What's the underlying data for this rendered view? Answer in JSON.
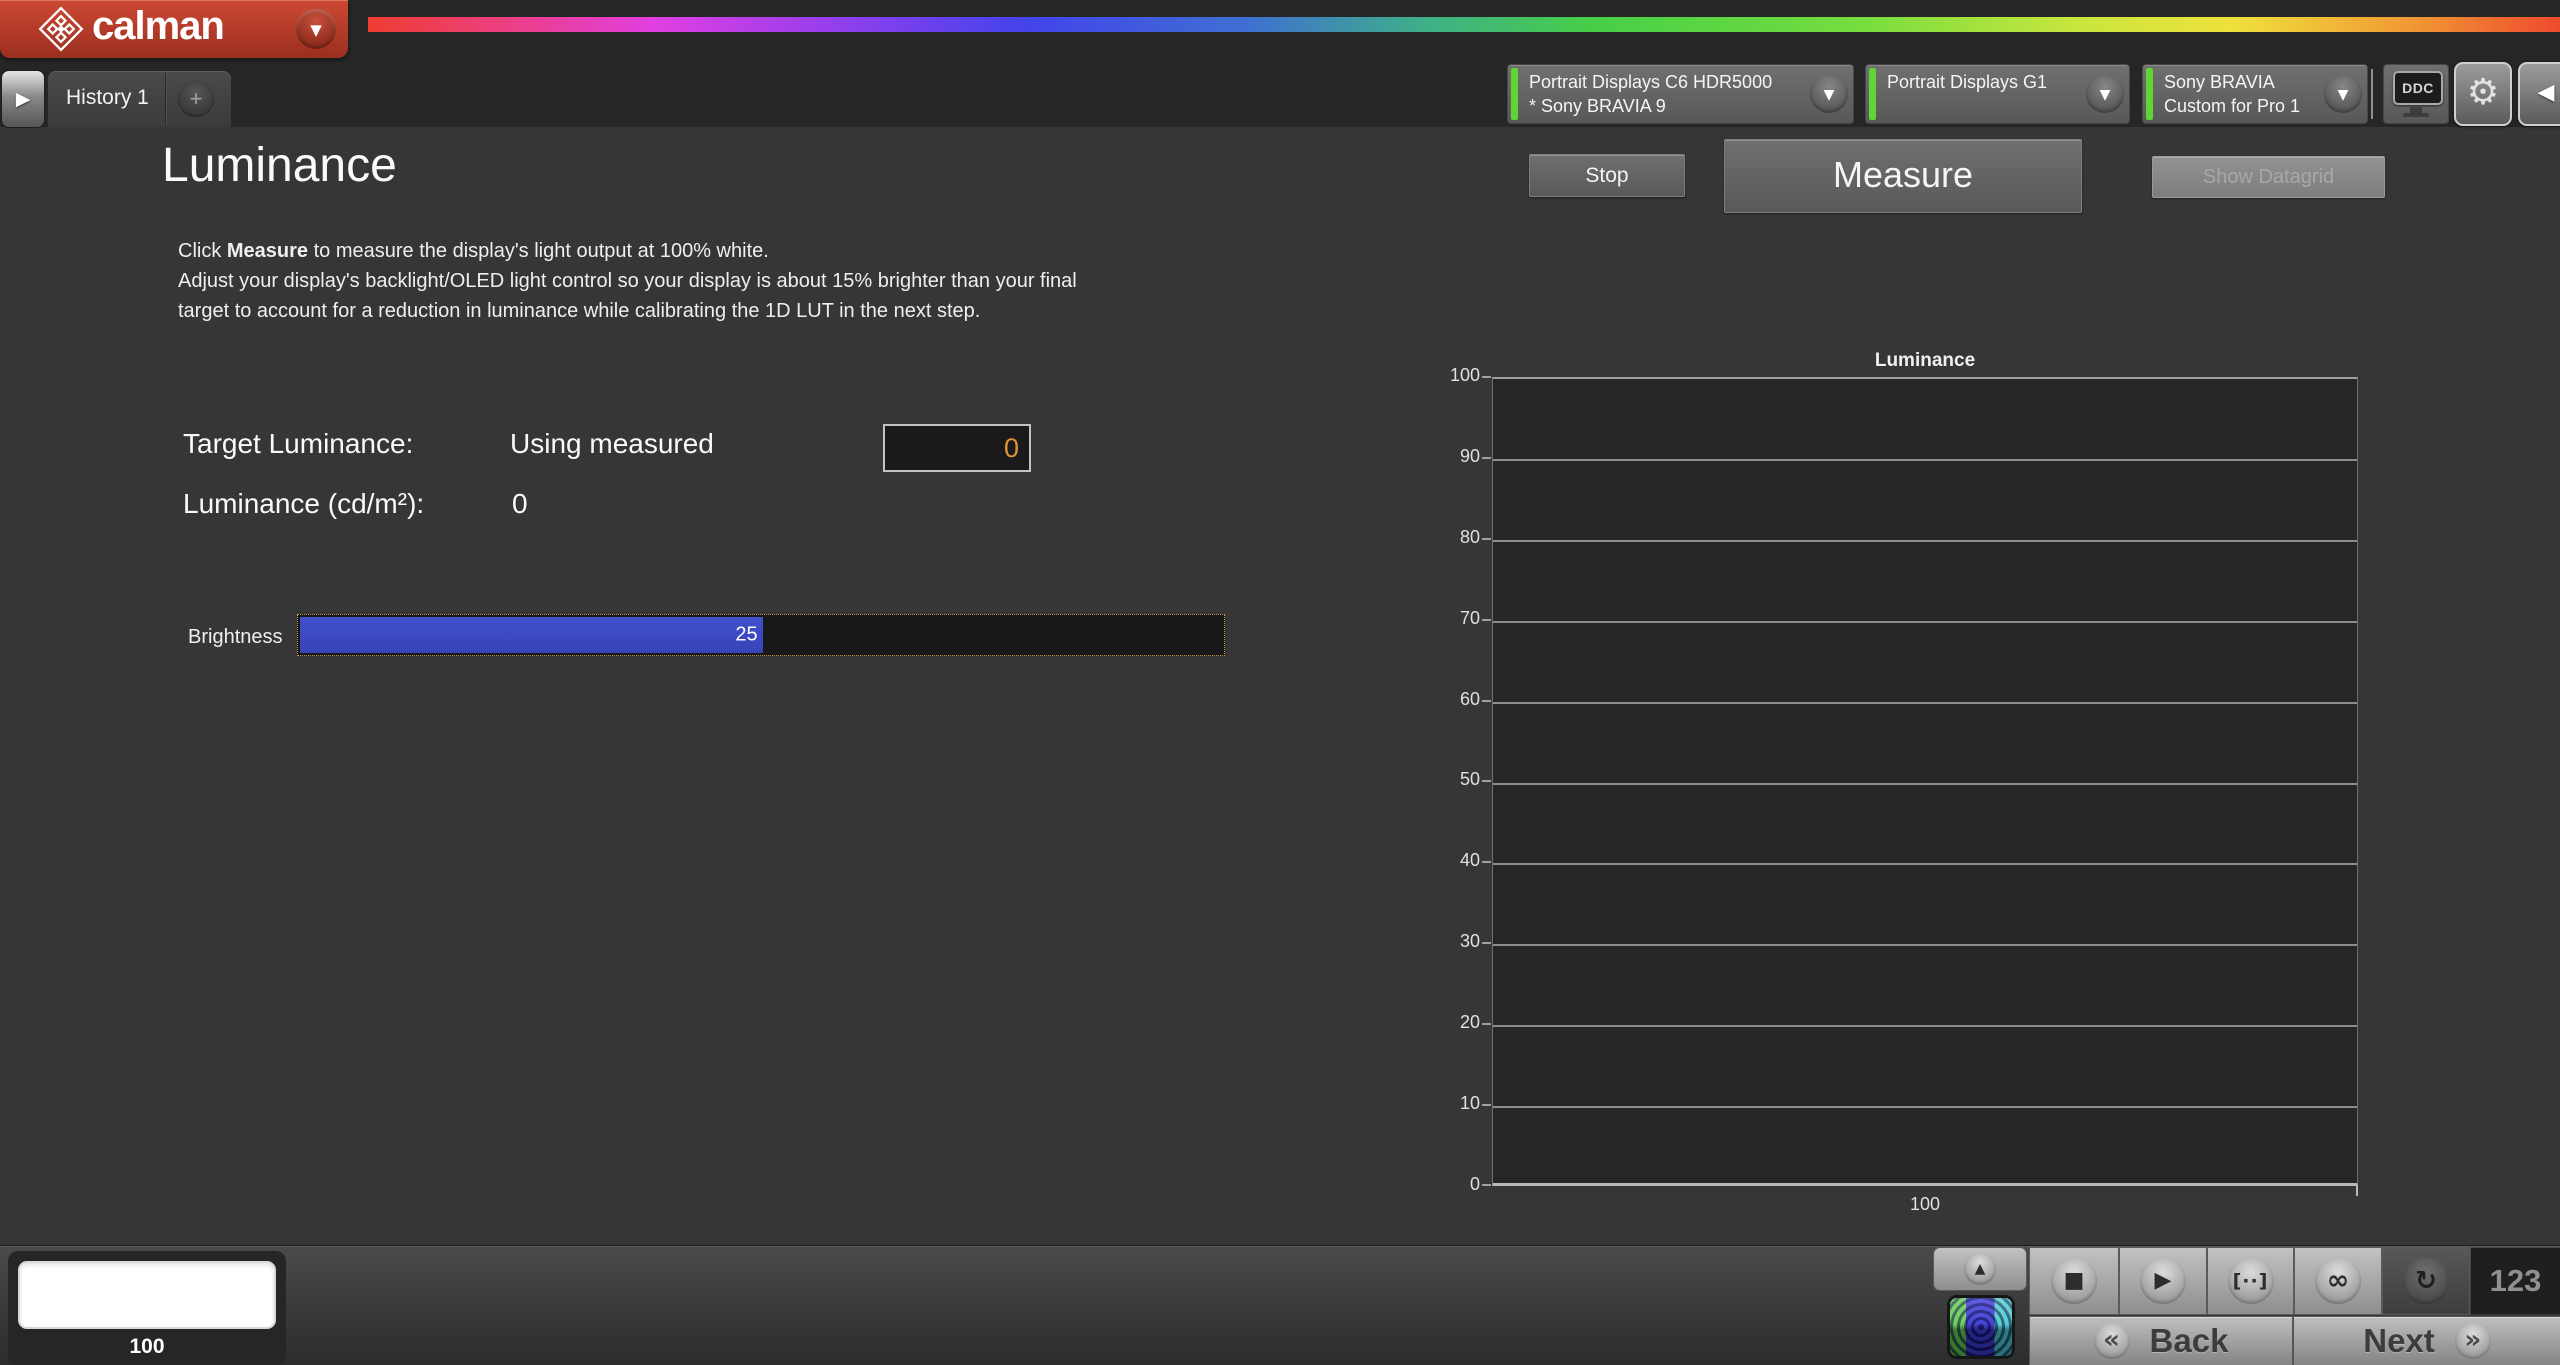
{
  "header": {
    "brand": "calman",
    "history_tab": "History 1",
    "add_tab": "+",
    "meter_panel": {
      "line1": "Portrait Displays C6 HDR5000",
      "line2": "* Sony BRAVIA 9"
    },
    "source_panel": {
      "line1": "Portrait Displays G1"
    },
    "display_panel": {
      "line1": "Sony BRAVIA",
      "line2": "Custom for Pro 1"
    },
    "ddc_label": "DDC"
  },
  "main": {
    "title": "Luminance",
    "instr1_pre": "Click ",
    "instr1_bold": "Measure",
    "instr1_post": " to measure the display's light output at 100% white.",
    "instr2": "Adjust your display's backlight/OLED light control so your display is about 15% brighter than your final",
    "instr3": "target to account for a reduction in luminance while calibrating the 1D LUT in the next step.",
    "stop": "Stop",
    "measure": "Measure",
    "show_datagrid": "Show Datagrid",
    "target_label": "Target Luminance:",
    "target_mode": "Using measured",
    "target_value": "0",
    "lum_label": "Luminance (cd/m²):",
    "lum_value": "0",
    "brightness_label": "Brightness",
    "brightness_value": "25"
  },
  "chart": {
    "title": "Luminance",
    "y_ticks": [
      "100",
      "90",
      "80",
      "70",
      "60",
      "50",
      "40",
      "30",
      "20",
      "10",
      "0"
    ],
    "x_tick": "100"
  },
  "chart_data": {
    "type": "line",
    "title": "Luminance",
    "ylim": [
      0,
      100
    ],
    "y_tick_values": [
      0,
      10,
      20,
      30,
      40,
      50,
      60,
      70,
      80,
      90,
      100
    ],
    "x_tick_labels": [
      "100"
    ],
    "grid": true,
    "series": []
  },
  "bottom": {
    "pattern_level": "100",
    "counter": "123",
    "back": "Back",
    "next": "Next"
  },
  "colors": {
    "brand_red": "#b23a28",
    "status_green": "#5fd636",
    "slider_blue": "#3b48c2",
    "value_orange": "#dd9434",
    "chart_bg": "#262626",
    "main_bg": "#363636"
  }
}
